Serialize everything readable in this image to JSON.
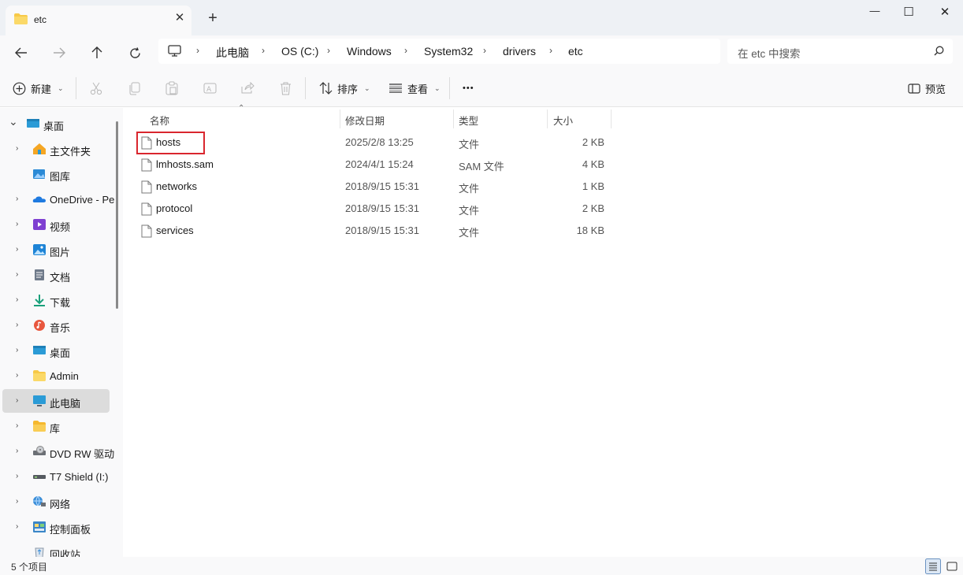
{
  "window": {
    "tab_title": "etc",
    "tab_close": "✕",
    "new_tab": "+",
    "minimize": "—",
    "maximize": "☐",
    "close": "✕"
  },
  "address": {
    "crumbs": [
      "此电脑",
      "OS (C:)",
      "Windows",
      "System32",
      "drivers",
      "etc"
    ],
    "separator": "›"
  },
  "search": {
    "placeholder": "在 etc 中搜索"
  },
  "toolbar": {
    "new_label": "新建",
    "sort_label": "排序",
    "view_label": "查看",
    "more_label": "•••",
    "preview_label": "预览"
  },
  "sidebar": {
    "items": [
      {
        "label": "桌面",
        "icon": "desktop-icon",
        "expanded": true
      },
      {
        "label": "主文件夹",
        "icon": "home-icon"
      },
      {
        "label": "图库",
        "icon": "gallery-icon"
      },
      {
        "label": "OneDrive - Pe",
        "icon": "onedrive-icon"
      },
      {
        "label": "视频",
        "icon": "videos-icon"
      },
      {
        "label": "图片",
        "icon": "pictures-icon"
      },
      {
        "label": "文档",
        "icon": "documents-icon"
      },
      {
        "label": "下载",
        "icon": "downloads-icon"
      },
      {
        "label": "音乐",
        "icon": "music-icon"
      },
      {
        "label": "桌面",
        "icon": "desktop-icon"
      },
      {
        "label": "Admin",
        "icon": "folder-icon"
      },
      {
        "label": "此电脑",
        "icon": "this-pc-icon",
        "selected": true
      },
      {
        "label": "库",
        "icon": "library-icon"
      },
      {
        "label": "DVD RW 驱动",
        "icon": "dvd-drive-icon"
      },
      {
        "label": "T7 Shield (I:)",
        "icon": "usb-drive-icon"
      },
      {
        "label": "网络",
        "icon": "network-icon"
      },
      {
        "label": "控制面板",
        "icon": "control-panel-icon"
      },
      {
        "label": "回收站",
        "icon": "recycle-bin-icon"
      }
    ]
  },
  "columns": {
    "name": "名称",
    "modified": "修改日期",
    "type": "类型",
    "size": "大小"
  },
  "files": [
    {
      "name": "hosts",
      "modified": "2025/2/8 13:25",
      "type": "文件",
      "size": "2 KB"
    },
    {
      "name": "lmhosts.sam",
      "modified": "2024/4/1 15:24",
      "type": "SAM 文件",
      "size": "4 KB"
    },
    {
      "name": "networks",
      "modified": "2018/9/15 15:31",
      "type": "文件",
      "size": "1 KB"
    },
    {
      "name": "protocol",
      "modified": "2018/9/15 15:31",
      "type": "文件",
      "size": "2 KB"
    },
    {
      "name": "services",
      "modified": "2018/9/15 15:31",
      "type": "文件",
      "size": "18 KB"
    }
  ],
  "status": {
    "count": "5 个项目"
  },
  "colors": {
    "highlight": "#d9262e",
    "accent": "#0067c0",
    "folder": "#f7c948"
  }
}
